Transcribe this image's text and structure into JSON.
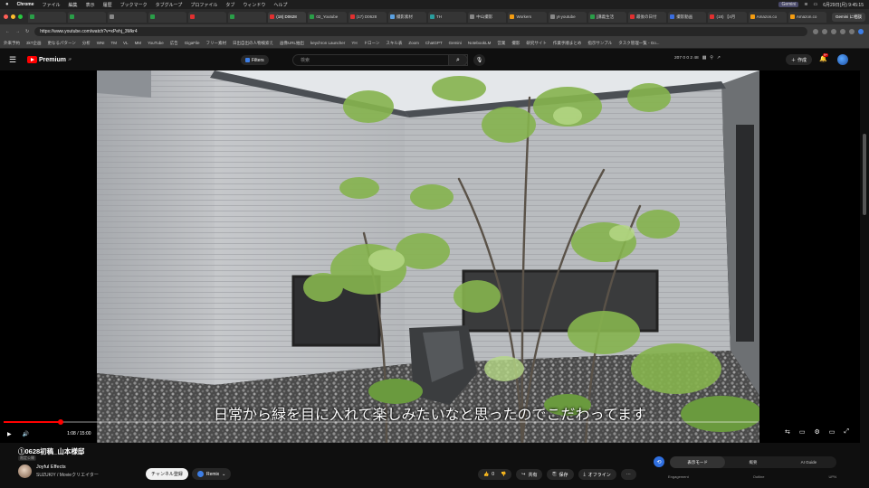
{
  "menubar": {
    "apple": "",
    "app": "Chrome",
    "items": [
      "ファイル",
      "編集",
      "表示",
      "履歴",
      "ブックマーク",
      "タブグループ",
      "プロファイル",
      "タブ",
      "ウィンドウ",
      "ヘルプ"
    ],
    "gemini_mini": "Gemini",
    "clock": "6月29日(月) 9:45:15"
  },
  "tabs": [
    {
      "label": "",
      "color": "#2a9d48"
    },
    {
      "label": "",
      "color": "#2a9d48"
    },
    {
      "label": "",
      "color": "#888"
    },
    {
      "label": "",
      "color": "#2a9d48"
    },
    {
      "label": "",
      "color": "#e03030"
    },
    {
      "label": "",
      "color": "#2a9d48"
    },
    {
      "label": "(18) D0628",
      "color": "#e03030",
      "active": true
    },
    {
      "label": "02_Youtube",
      "color": "#2a9d48"
    },
    {
      "label": "(17) D0628",
      "color": "#e03030"
    },
    {
      "label": "撮影素材",
      "color": "#5aa0e0"
    },
    {
      "label": "TH",
      "color": "#2a9d9d"
    },
    {
      "label": "中山撮影",
      "color": "#888"
    },
    {
      "label": "Workers",
      "color": "#f39c12"
    },
    {
      "label": "yt-youtube",
      "color": "#888"
    },
    {
      "label": "[講義生活",
      "color": "#2a9d48"
    },
    {
      "label": "最後の日付",
      "color": "#e03030"
    },
    {
      "label": "撮影動画",
      "color": "#3a6ee0"
    },
    {
      "label": "(18) 【4月",
      "color": "#e03030"
    },
    {
      "label": "Amazon.co",
      "color": "#f39c12"
    },
    {
      "label": "Amazon.co",
      "color": "#f39c12"
    }
  ],
  "gemini_button": "Gemini に相談",
  "address": {
    "url": "https://www.youtube.com/watch?v=xPehj_3Mkr4"
  },
  "bookmarks": [
    "外来予約",
    "3kT企画",
    "更なるパターン",
    "分析",
    "WNI",
    "TM",
    "VL",
    "MM",
    "YouTube",
    "広告",
    "GigaFile",
    "フリー素材",
    "日出自出の人物検索え",
    "画像URL抽出",
    "keychron Launcher",
    "YH",
    "ドローン",
    "スキル表",
    "Zoom",
    "ChatGPT",
    "Gemini",
    "NotebookLM",
    "営業",
    "撮影",
    "研究サイト",
    "作業手順まとめ",
    "指示サンプル",
    "タスク管理一覧 - Go..."
  ],
  "ytheader": {
    "premium_label": "Premium",
    "premium_sup": "JP",
    "filters_label": "Filters",
    "search_placeholder": "検索",
    "stats": "207  0  0  2  48",
    "create_label": "作成",
    "bell_count": "9+"
  },
  "player": {
    "subtitle": "日常から緑を目に入れて楽しみたいなと思ったのでこだわってます",
    "time": "1:08 / 15:00",
    "progress": 0.075
  },
  "video": {
    "title": "①0628初稿_山本様邸",
    "badge": "限定公開",
    "channel": "Joyful Effects",
    "channel_sub": "SUZUKIY / Movieクリエイター",
    "subscribe_label": "チャンネル登録",
    "remix_label": "Remix",
    "like_count": "0",
    "share_label": "共有",
    "save_label": "保存",
    "offline_label": "オフライン"
  },
  "sidepanel": {
    "tabs": [
      "表示モード",
      "概要",
      "AI Guide"
    ],
    "labels": [
      "Engagement",
      "Outline",
      "UPN"
    ]
  }
}
